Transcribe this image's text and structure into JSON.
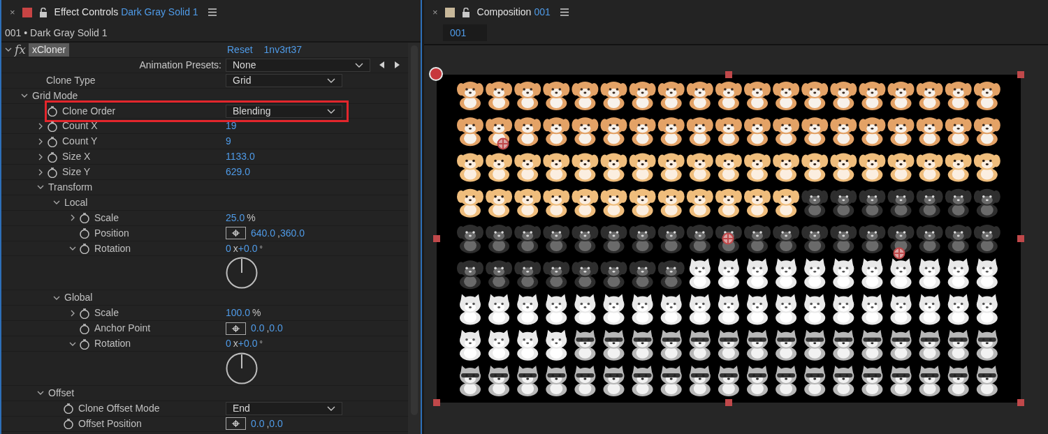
{
  "effect_panel": {
    "tab": {
      "close": "×",
      "title": "Effect Controls",
      "layer": "Dark Gray Solid 1",
      "color": "#c84444"
    },
    "breadcrumb": "001 • Dark Gray Solid 1",
    "effect": {
      "icon": "fx",
      "name": "xCloner",
      "expanded": true,
      "reset": "Reset",
      "about": "1nv3rt37"
    },
    "properties": [
      {
        "label": "Animation Presets:",
        "kind": "preset",
        "value": "None"
      },
      {
        "label": "Clone Type",
        "kind": "dropdown",
        "value": "Grid",
        "stopwatch": false,
        "highlighted": false
      },
      {
        "label": "Grid Mode",
        "kind": "group",
        "expanded": true,
        "children": [
          {
            "label": "Clone Order",
            "kind": "dropdown",
            "value": "Blending",
            "stopwatch": true,
            "highlighted": true
          },
          {
            "label": "Count X",
            "kind": "number",
            "expanded": false,
            "stopwatch": true,
            "value": "19"
          },
          {
            "label": "Count Y",
            "kind": "number",
            "expanded": false,
            "stopwatch": true,
            "value": "9"
          },
          {
            "label": "Size X",
            "kind": "number",
            "expanded": false,
            "stopwatch": true,
            "value": "1133.0"
          },
          {
            "label": "Size Y",
            "kind": "number",
            "expanded": false,
            "stopwatch": true,
            "value": "629.0"
          },
          {
            "label": "Transform",
            "kind": "group",
            "expanded": true,
            "children": [
              {
                "label": "Local",
                "kind": "group",
                "expanded": true,
                "children": [
                  {
                    "label": "Scale",
                    "kind": "number",
                    "expanded": false,
                    "stopwatch": true,
                    "value": "25.0",
                    "unit": "%"
                  },
                  {
                    "label": "Position",
                    "kind": "point",
                    "stopwatch": true,
                    "values": [
                      "640.0",
                      "360.0"
                    ],
                    "separator": ","
                  },
                  {
                    "label": "Rotation",
                    "kind": "angle",
                    "expanded": true,
                    "stopwatch": true,
                    "revolutions": "0",
                    "separator": "x",
                    "degrees": "+0.0",
                    "unit": "°"
                  }
                ]
              },
              {
                "label": "Global",
                "kind": "group",
                "expanded": true,
                "children": [
                  {
                    "label": "Scale",
                    "kind": "number",
                    "expanded": false,
                    "stopwatch": true,
                    "value": "100.0",
                    "unit": "%"
                  },
                  {
                    "label": "Anchor Point",
                    "kind": "point",
                    "stopwatch": true,
                    "values": [
                      "0.0",
                      "0.0"
                    ],
                    "separator": ","
                  },
                  {
                    "label": "Rotation",
                    "kind": "angle",
                    "expanded": true,
                    "stopwatch": true,
                    "revolutions": "0",
                    "separator": "x",
                    "degrees": "+0.0",
                    "unit": "°"
                  }
                ]
              }
            ]
          },
          {
            "label": "Offset",
            "kind": "group",
            "expanded": true,
            "children": [
              {
                "label": "Clone Offset Mode",
                "kind": "dropdown",
                "value": "End",
                "stopwatch": true,
                "highlighted": false
              },
              {
                "label": "Offset Position",
                "kind": "point",
                "stopwatch": true,
                "values": [
                  "0.0",
                  "0.0"
                ],
                "separator": ","
              }
            ]
          }
        ]
      }
    ]
  },
  "composition_panel": {
    "tab": {
      "close": "×",
      "title": "Composition",
      "name": "001",
      "color": "#c8b89a"
    },
    "comp_button": "001"
  }
}
